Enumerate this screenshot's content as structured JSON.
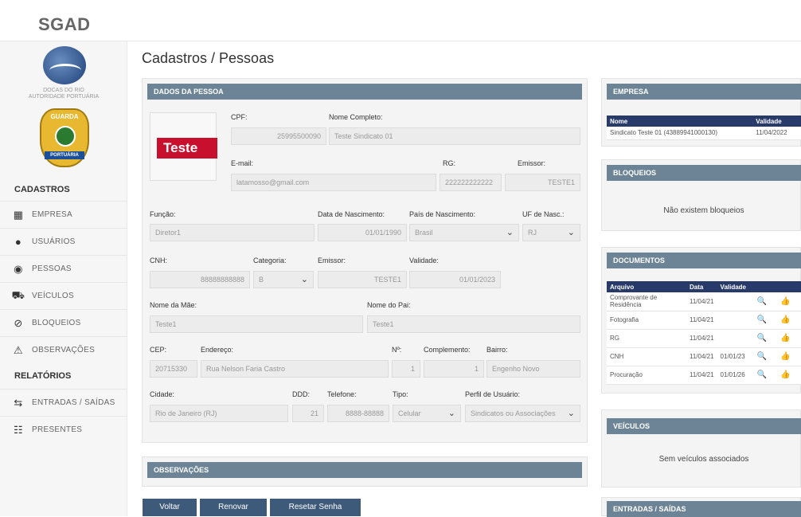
{
  "app": {
    "brand": "SGAD",
    "logo_text": "DOCAS DO RIO\nAUTORIDADE PORTUÁRIA",
    "badge_top": "GUARDA",
    "badge_bottom": "PORTUÁRIA"
  },
  "sidebar": {
    "cadastros": "CADASTROS",
    "relatorios": "RELATÓRIOS",
    "items": [
      {
        "label": "EMPRESA",
        "icon": "building-icon"
      },
      {
        "label": "USUÁRIOS",
        "icon": "user-icon"
      },
      {
        "label": "PESSOAS",
        "icon": "person-icon"
      },
      {
        "label": "VEÍCULOS",
        "icon": "car-icon"
      },
      {
        "label": "BLOQUEIOS",
        "icon": "block-icon"
      },
      {
        "label": "OBSERVAÇÕES",
        "icon": "warning-icon"
      }
    ],
    "reports": [
      {
        "label": "ENTRADAS / SAÍDAS",
        "icon": "arrows-icon"
      },
      {
        "label": "PRESENTES",
        "icon": "group-icon"
      }
    ]
  },
  "page_title": "Cadastros / Pessoas",
  "person": {
    "header": "DADOS DA PESSOA",
    "photo_text": "Teste",
    "cpf_label": "CPF:",
    "cpf": "25995500090",
    "name_label": "Nome Completo:",
    "name": "Teste Sindicato 01",
    "email_label": "E-mail:",
    "email": "latamosso@gmail.com",
    "rg_label": "RG:",
    "rg": "222222222222",
    "emissor_label": "Emissor:",
    "emissor": "TESTE1",
    "funcao_label": "Função:",
    "funcao": "Diretor1",
    "nasc_label": "Data de Nascimento:",
    "nasc": "01/01/1990",
    "pais_label": "País de Nascimento:",
    "pais": "Brasil",
    "uf_label": "UF de Nasc.:",
    "uf": "RJ",
    "cnh_label": "CNH:",
    "cnh": "88888888888",
    "cat_label": "Categoria:",
    "cat": "B",
    "cnh_emissor_label": "Emissor:",
    "cnh_emissor": "TESTE1",
    "validade_label": "Validade:",
    "validade": "01/01/2023",
    "mae_label": "Nome da Mãe:",
    "mae": "Teste1",
    "pai_label": "Nome do Pai:",
    "pai": "Teste1",
    "cep_label": "CEP:",
    "cep": "20715330",
    "end_label": "Endereço:",
    "end": "Rua Nelson Faria Castro",
    "num_label": "Nº:",
    "num": "1",
    "comp_label": "Complemento:",
    "comp": "1",
    "bairro_label": "Bairro:",
    "bairro": "Engenho Novo",
    "cidade_label": "Cidade:",
    "cidade": "Rio de Janeiro (RJ)",
    "ddd_label": "DDD:",
    "ddd": "21",
    "tel_label": "Telefone:",
    "tel": "8888-88888",
    "tipo_label": "Tipo:",
    "tipo": "Celular",
    "perfil_label": "Perfil de Usuário:",
    "perfil": "Sindicatos ou Associações"
  },
  "obs": {
    "header": "OBSERVAÇÕES"
  },
  "buttons": {
    "voltar": "Voltar",
    "renovar": "Renovar",
    "resetar": "Resetar Senha"
  },
  "empresa": {
    "header": "EMPRESA",
    "col_nome": "Nome",
    "col_validade": "Validade",
    "nome": "Sindicato Teste 01 (43889941000130)",
    "validade": "11/04/2022"
  },
  "bloqueios": {
    "header": "BLOQUEIOS",
    "empty": "Não existem bloqueios"
  },
  "documentos": {
    "header": "DOCUMENTOS",
    "cols": [
      "Arquivo",
      "Data",
      "Validade"
    ],
    "rows": [
      {
        "arquivo": "Comprovante de Residência",
        "data": "11/04/21",
        "validade": ""
      },
      {
        "arquivo": "Fotografia",
        "data": "11/04/21",
        "validade": ""
      },
      {
        "arquivo": "RG",
        "data": "11/04/21",
        "validade": ""
      },
      {
        "arquivo": "CNH",
        "data": "11/04/21",
        "validade": "01/01/23"
      },
      {
        "arquivo": "Procuração",
        "data": "11/04/21",
        "validade": "01/01/26"
      }
    ]
  },
  "veiculos": {
    "header": "VEÍCULOS",
    "empty": "Sem veículos associados"
  },
  "entradas": {
    "header": "ENTRADAS / SAÍDAS"
  }
}
